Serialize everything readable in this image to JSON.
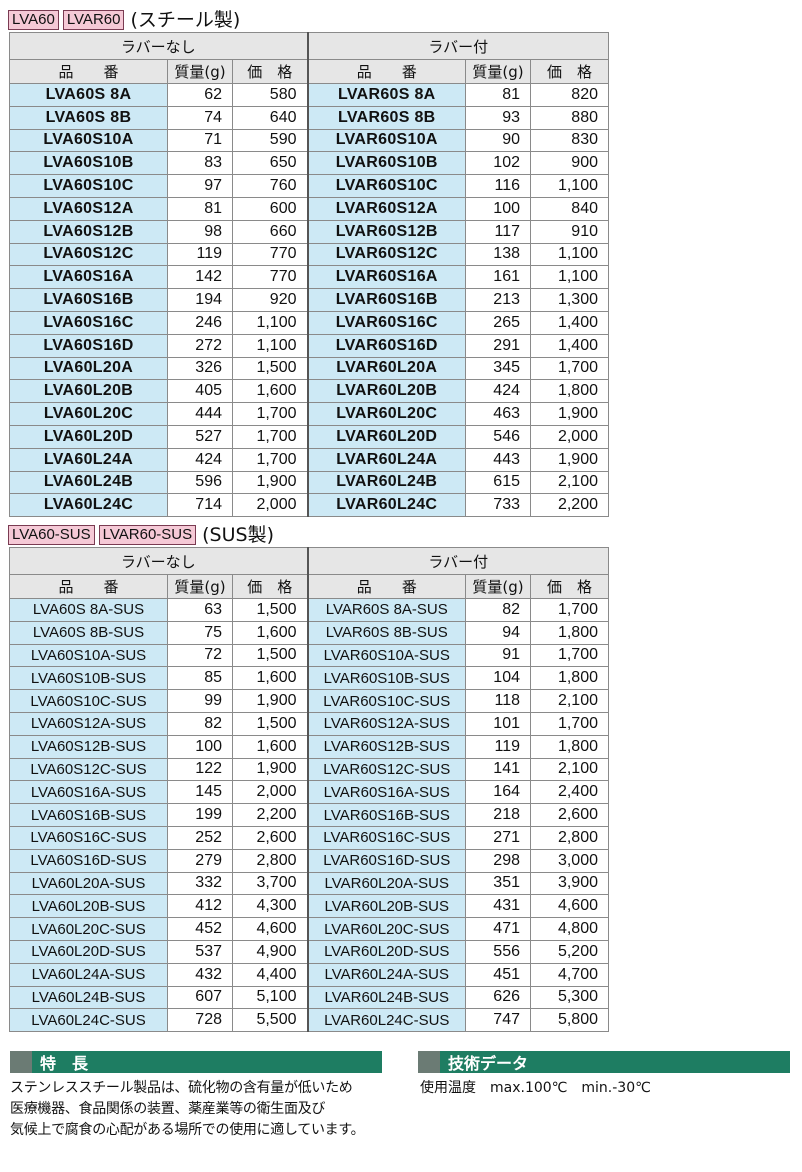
{
  "steel": {
    "tags": [
      "LVA60",
      "LVAR60"
    ],
    "title": "(スチール製)",
    "group_left": "ラバーなし",
    "group_right": "ラバー付",
    "col_part": "品　　番",
    "col_mass": "質量(g)",
    "col_price": "価　格",
    "rows": [
      [
        "LVA60S  8A",
        "62",
        "580",
        "LVAR60S  8A",
        "81",
        "820"
      ],
      [
        "LVA60S  8B",
        "74",
        "640",
        "LVAR60S  8B",
        "93",
        "880"
      ],
      [
        "LVA60S10A",
        "71",
        "590",
        "LVAR60S10A",
        "90",
        "830"
      ],
      [
        "LVA60S10B",
        "83",
        "650",
        "LVAR60S10B",
        "102",
        "900"
      ],
      [
        "LVA60S10C",
        "97",
        "760",
        "LVAR60S10C",
        "116",
        "1,100"
      ],
      [
        "LVA60S12A",
        "81",
        "600",
        "LVAR60S12A",
        "100",
        "840"
      ],
      [
        "LVA60S12B",
        "98",
        "660",
        "LVAR60S12B",
        "117",
        "910"
      ],
      [
        "LVA60S12C",
        "119",
        "770",
        "LVAR60S12C",
        "138",
        "1,100"
      ],
      [
        "LVA60S16A",
        "142",
        "770",
        "LVAR60S16A",
        "161",
        "1,100"
      ],
      [
        "LVA60S16B",
        "194",
        "920",
        "LVAR60S16B",
        "213",
        "1,300"
      ],
      [
        "LVA60S16C",
        "246",
        "1,100",
        "LVAR60S16C",
        "265",
        "1,400"
      ],
      [
        "LVA60S16D",
        "272",
        "1,100",
        "LVAR60S16D",
        "291",
        "1,400"
      ],
      [
        "LVA60L20A",
        "326",
        "1,500",
        "LVAR60L20A",
        "345",
        "1,700"
      ],
      [
        "LVA60L20B",
        "405",
        "1,600",
        "LVAR60L20B",
        "424",
        "1,800"
      ],
      [
        "LVA60L20C",
        "444",
        "1,700",
        "LVAR60L20C",
        "463",
        "1,900"
      ],
      [
        "LVA60L20D",
        "527",
        "1,700",
        "LVAR60L20D",
        "546",
        "2,000"
      ],
      [
        "LVA60L24A",
        "424",
        "1,700",
        "LVAR60L24A",
        "443",
        "1,900"
      ],
      [
        "LVA60L24B",
        "596",
        "1,900",
        "LVAR60L24B",
        "615",
        "2,100"
      ],
      [
        "LVA60L24C",
        "714",
        "2,000",
        "LVAR60L24C",
        "733",
        "2,200"
      ]
    ]
  },
  "sus": {
    "tags": [
      "LVA60-SUS",
      "LVAR60-SUS"
    ],
    "title": "(SUS製)",
    "group_left": "ラバーなし",
    "group_right": "ラバー付",
    "col_part": "品　　番",
    "col_mass": "質量(g)",
    "col_price": "価　格",
    "rows": [
      [
        "LVA60S  8A-SUS",
        "63",
        "1,500",
        "LVAR60S  8A-SUS",
        "82",
        "1,700"
      ],
      [
        "LVA60S  8B-SUS",
        "75",
        "1,600",
        "LVAR60S  8B-SUS",
        "94",
        "1,800"
      ],
      [
        "LVA60S10A-SUS",
        "72",
        "1,500",
        "LVAR60S10A-SUS",
        "91",
        "1,700"
      ],
      [
        "LVA60S10B-SUS",
        "85",
        "1,600",
        "LVAR60S10B-SUS",
        "104",
        "1,800"
      ],
      [
        "LVA60S10C-SUS",
        "99",
        "1,900",
        "LVAR60S10C-SUS",
        "118",
        "2,100"
      ],
      [
        "LVA60S12A-SUS",
        "82",
        "1,500",
        "LVAR60S12A-SUS",
        "101",
        "1,700"
      ],
      [
        "LVA60S12B-SUS",
        "100",
        "1,600",
        "LVAR60S12B-SUS",
        "119",
        "1,800"
      ],
      [
        "LVA60S12C-SUS",
        "122",
        "1,900",
        "LVAR60S12C-SUS",
        "141",
        "2,100"
      ],
      [
        "LVA60S16A-SUS",
        "145",
        "2,000",
        "LVAR60S16A-SUS",
        "164",
        "2,400"
      ],
      [
        "LVA60S16B-SUS",
        "199",
        "2,200",
        "LVAR60S16B-SUS",
        "218",
        "2,600"
      ],
      [
        "LVA60S16C-SUS",
        "252",
        "2,600",
        "LVAR60S16C-SUS",
        "271",
        "2,800"
      ],
      [
        "LVA60S16D-SUS",
        "279",
        "2,800",
        "LVAR60S16D-SUS",
        "298",
        "3,000"
      ],
      [
        "LVA60L20A-SUS",
        "332",
        "3,700",
        "LVAR60L20A-SUS",
        "351",
        "3,900"
      ],
      [
        "LVA60L20B-SUS",
        "412",
        "4,300",
        "LVAR60L20B-SUS",
        "431",
        "4,600"
      ],
      [
        "LVA60L20C-SUS",
        "452",
        "4,600",
        "LVAR60L20C-SUS",
        "471",
        "4,800"
      ],
      [
        "LVA60L20D-SUS",
        "537",
        "4,900",
        "LVAR60L20D-SUS",
        "556",
        "5,200"
      ],
      [
        "LVA60L24A-SUS",
        "432",
        "4,400",
        "LVAR60L24A-SUS",
        "451",
        "4,700"
      ],
      [
        "LVA60L24B-SUS",
        "607",
        "5,100",
        "LVAR60L24B-SUS",
        "626",
        "5,300"
      ],
      [
        "LVA60L24C-SUS",
        "728",
        "5,500",
        "LVAR60L24C-SUS",
        "747",
        "5,800"
      ]
    ]
  },
  "features": {
    "title": "特　長",
    "lines": [
      "ステンレススチール製品は、硫化物の含有量が低いため",
      "医療機器、食品関係の装置、薬産業等の衛生面及び",
      "気候上で腐食の心配がある場所での使用に適しています。"
    ]
  },
  "tech": {
    "title": "技術データ",
    "label": "使用温度",
    "max": "max.100℃",
    "min": "min.-30℃"
  },
  "colors": {
    "tag_bg": "#f5c9d6",
    "part_cell_bg": "#cde9f5",
    "header_bg": "#e6e6e6",
    "bar_green": "#1e7d62"
  }
}
